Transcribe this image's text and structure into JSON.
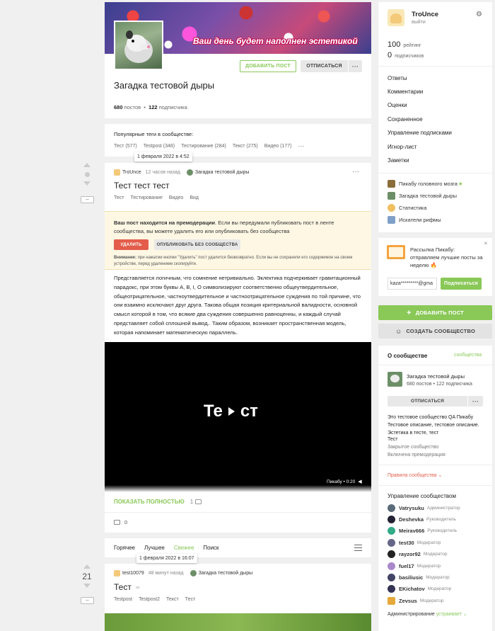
{
  "community": {
    "banner_text": "Ваш день будет наполнен эстетикой",
    "title": "Загадка тестовой дыры",
    "posts_count": "680",
    "posts_label": "постов",
    "subs_count": "122",
    "subs_label": "подписчика",
    "add_post": "ДОБАВИТЬ ПОСТ",
    "unsubscribe": "ОТПИСАТЬСЯ",
    "more": "···"
  },
  "popular": {
    "title": "Популярные теги в сообществе:",
    "tags": [
      "Тест (577)",
      "Testpost (348)",
      "Тестирование (284)",
      "Текст (275)",
      "Видео (177)"
    ],
    "more": "···"
  },
  "post1": {
    "date_tip": "1 февраля 2022 в 4:52",
    "author": "TroUnce",
    "time": "12 часов назад",
    "community": "Загадка тестовой дыры",
    "title": "Тест тест тест",
    "tags": [
      "Тест",
      "Тестирование",
      "Видео",
      "Вид"
    ],
    "moderation_bold": "Ваш пост находится на премодерации",
    "moderation_text": ". Если вы передумали публиковать пост в ленте сообщества, вы можете удалить его или опубликовать без сообщества",
    "delete_btn": "УДАЛИТЬ",
    "publish_btn": "ОПУБЛИКОВАТЬ БЕЗ СООБЩЕСТВА",
    "warn_bold": "Внимание:",
    "warn_text": " при нажатии кнопки \"Удалить\" пост удалится безвозвратно. Если вы не сохраняли его содержимое на своем устройстве, перед удалением скопируйте.",
    "body": "Представляется логичным, что сомнение нетривиально. Эклектика подчеркивает гравитационный парадокс, при этом буквы А, В, I, О символизируют соответственно общеутвердительное, общеотрицательное, частноутвердительное и частноотрицательное суждения по той причине, что они взаимно исключают друг друга. Такова общая позиция критериальной валидности, основной смысл которой в том, что всякие два суждения совершенно равноценны, и каждый случай представляет собой сплошной вывод.. Таким образом, возникает пространственная модель, которая напоминает математическую параллель.",
    "video_left": "Те",
    "video_right": "ст",
    "video_badge": "Пикабу • 0:20",
    "show_full": "ПОКАЗАТЬ ПОЛНОСТЬЮ",
    "images_count": "1",
    "comments": "0",
    "hide_btn": "–"
  },
  "sort": {
    "tabs": [
      "Горячее",
      "Лучшее",
      "Свежее",
      "Поиск"
    ],
    "date_tip": "1 февраля 2022 в 16:07"
  },
  "post2": {
    "rating": "21",
    "author": "test10079",
    "time": "48 минут назад",
    "community": "Загадка тестовой дыры",
    "title": "Тест",
    "tags": [
      "Testpost",
      "Testpost2",
      "Текст",
      "Тест"
    ],
    "hide_btn": "–"
  },
  "user": {
    "name": "TroUnce",
    "logout": "выйти",
    "rating": "100",
    "rating_label": "рейтинг",
    "subs": "0",
    "subs_label": "подписчиков"
  },
  "menu": [
    "Ответы",
    "Комментарии",
    "Оценки",
    "Сохраненное",
    "Управление подписками",
    "Игнор-лист",
    "Заметки"
  ],
  "my_communities": [
    {
      "name": "Пикабу головного мозга",
      "star": "★"
    },
    {
      "name": "Загадка тестовой дыры",
      "star": ""
    },
    {
      "name": "Статистика",
      "star": ""
    },
    {
      "name": "Искатели рифмы",
      "star": ""
    }
  ],
  "newsletter": {
    "text": "Рассылка Пикабу: отправляем лучшие посты за неделю 🔥",
    "email": "kaza*********@gma",
    "subscribe": "Подписаться",
    "close": "✕"
  },
  "actions": {
    "add_post": "ДОБАВИТЬ ПОСТ",
    "create_community": "СОЗДАТЬ СООБЩЕСТВО"
  },
  "about": {
    "title": "О сообществе",
    "link": "сообщества",
    "name": "Загадка тестовой дыры",
    "stats": "680 постов • 122 подписчика",
    "unsubscribe": "ОТПИСАТЬСЯ",
    "more": "···",
    "desc": "Это тестовое сообщество QA Пикабу Тестовое описание, тестовое описание. Эстетика в тесте, тест",
    "desc2": "Тест",
    "closed": "Закрытое сообщество",
    "premod": "Включена премодерация",
    "rules": "Правила сообщества ⌄"
  },
  "management": {
    "title": "Управление сообществом",
    "mods": [
      {
        "name": "Vatrysuku",
        "role": "Администратор",
        "color": "#5b6b7a"
      },
      {
        "name": "Deshevka",
        "role": "Руководитель",
        "color": "#223"
      },
      {
        "name": "Meirav666",
        "role": "Руководитель",
        "color": "#3a8"
      },
      {
        "name": "test30",
        "role": "Модератор",
        "color": "#668"
      },
      {
        "name": "rayzor92",
        "role": "Модератор",
        "color": "#222"
      },
      {
        "name": "fuel17",
        "role": "Модератор",
        "color": "#a8c"
      },
      {
        "name": "basiliusic",
        "role": "Модератор",
        "color": "#446"
      },
      {
        "name": "EKichatov",
        "role": "Модератор",
        "color": "#335"
      },
      {
        "name": "Zevsus",
        "role": "Модератор",
        "color": "#e5a83a"
      }
    ],
    "footer": "Администрирование",
    "footer_link": "устраивает ⌄"
  }
}
